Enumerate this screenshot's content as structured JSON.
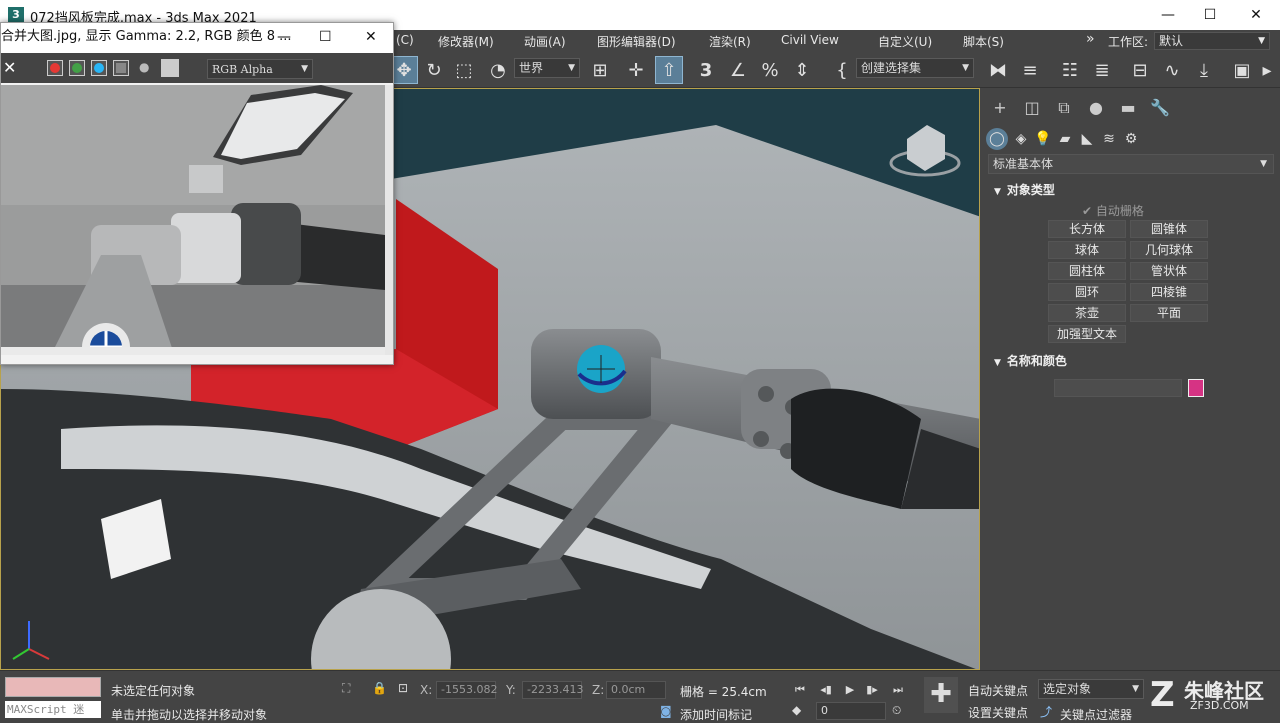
{
  "window": {
    "title": "072挡风板完成.max - 3ds Max 2021",
    "app_icon": "3",
    "controls": [
      "—",
      "☐",
      "✕"
    ]
  },
  "menubar": {
    "items": [
      "(C)",
      "修改器(M)",
      "动画(A)",
      "图形编辑器(D)",
      "渲染(R)",
      "Civil View",
      "自定义(U)",
      "脚本(S)"
    ],
    "overflow": "»",
    "workspace_label": "工作区:",
    "workspace_value": "默认"
  },
  "toolbar": {
    "coord_system": "世界",
    "selection_set": "创建选择集",
    "icons": [
      "move-icon",
      "rotate-icon",
      "scale-icon",
      "select-region-icon",
      "pivot-icon",
      "snap-3-icon",
      "angle-snap-icon",
      "percent-snap-icon",
      "spinner-snap-icon",
      "edit-named-icon",
      "mirror-icon",
      "align-icon",
      "layers-icon",
      "scene-explorer-icon",
      "ribbon-icon",
      "curve-editor-icon",
      "schematic-icon",
      "material-editor-icon",
      "render-setup-icon"
    ]
  },
  "framebuffer": {
    "title": "合并大图.jpg, 显示 Gamma: 2.2, RGB 颜色 8 ...",
    "channel": "RGB Alpha",
    "swatch_colors": [
      "#e53935",
      "#43a047",
      "#29b6f6"
    ]
  },
  "command_panel": {
    "category_dropdown": "标准基本体",
    "rollout_object_type": "对象类型",
    "auto_grid": "自动栅格",
    "primitives": [
      "长方体",
      "圆锥体",
      "球体",
      "几何球体",
      "圆柱体",
      "管状体",
      "圆环",
      "四棱锥",
      "茶壶",
      "平面",
      "加强型文本"
    ],
    "rollout_name_color": "名称和颜色",
    "object_color": "#d63384"
  },
  "status": {
    "maxscript_label": "MAXScript 迷",
    "line1": "未选定任何对象",
    "line2": "单击并拖动以选择并移动对象",
    "x_label": "X:",
    "x_value": "-1553.082",
    "y_label": "Y:",
    "y_value": "-2233.413",
    "z_label": "Z:",
    "z_value": "0.0cm",
    "grid": "栅格 = 25.4cm",
    "add_time_tag": "添加时间标记",
    "frame": "0",
    "auto_key": "自动关键点",
    "set_key": "设置关键点",
    "selected_object": "选定对象",
    "key_filter": "关键点过滤器",
    "watermark": "朱峰社区",
    "watermark_sub": "ZF3D.COM"
  }
}
